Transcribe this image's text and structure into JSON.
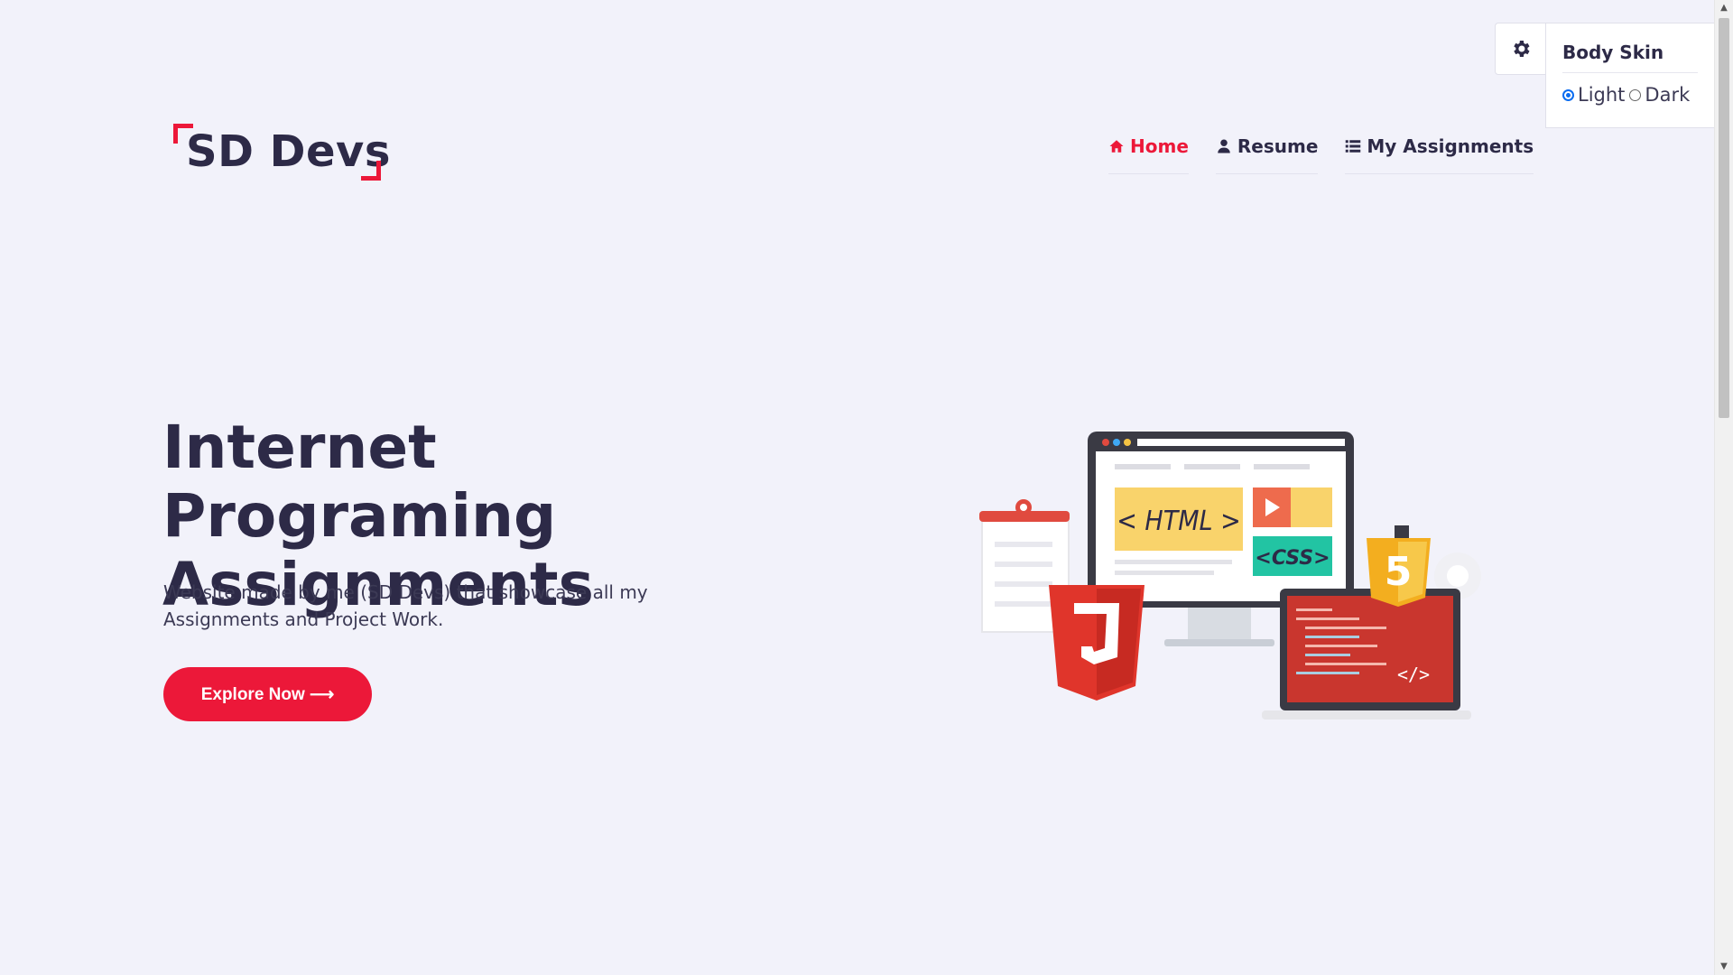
{
  "logo": {
    "text": "SD Devs"
  },
  "nav": {
    "items": [
      {
        "label": "Home",
        "icon": "home-icon",
        "active": true
      },
      {
        "label": "Resume",
        "icon": "user-icon",
        "active": false
      },
      {
        "label": "My Assignments",
        "icon": "list-icon",
        "active": false
      }
    ]
  },
  "settings": {
    "title": "Body Skin",
    "options": [
      {
        "label": "Light",
        "selected": true
      },
      {
        "label": "Dark",
        "selected": false
      }
    ],
    "icon": "gear-icon"
  },
  "hero": {
    "title_line1": "Internet Programing",
    "title_line2": "Assignments",
    "desc_line1": "Website made by me (SD Devs) that showcase all my",
    "desc_line2": "Assignments and Project Work.",
    "button_label": "Explore Now ⟶"
  },
  "illustration": {
    "html_tag": "< HTML >",
    "css_tag": "<CSS>",
    "html5_badge": "5",
    "code_tag": "</>"
  },
  "colors": {
    "accent": "#ec1839",
    "text": "#2d2a47",
    "background": "#f2f2fa"
  }
}
